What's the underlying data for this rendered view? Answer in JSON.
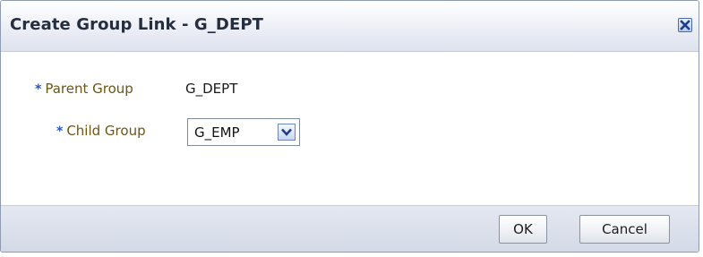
{
  "dialog": {
    "title": "Create Group Link - G_DEPT",
    "close_icon": "close-icon"
  },
  "form": {
    "required_marker": "*",
    "parent_group": {
      "label": "Parent Group",
      "value": "G_DEPT"
    },
    "child_group": {
      "label": "Child Group",
      "selected": "G_EMP",
      "dropdown_icon": "chevron-down-icon"
    }
  },
  "footer": {
    "ok_label": "OK",
    "cancel_label": "Cancel"
  }
}
